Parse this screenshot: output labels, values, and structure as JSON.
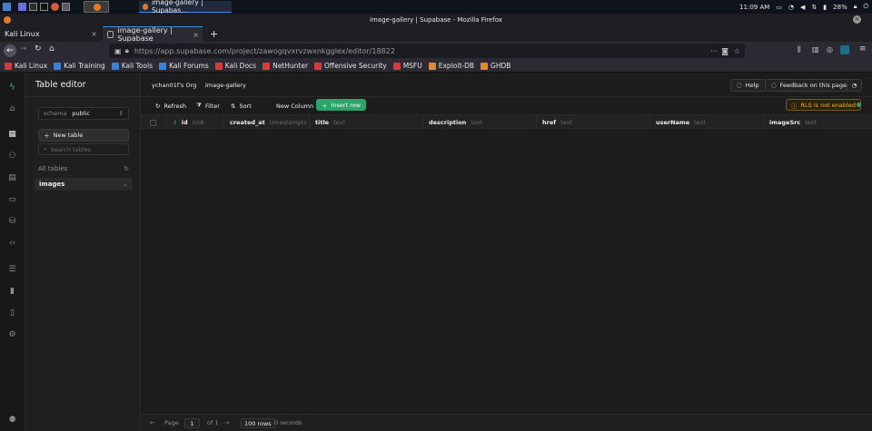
{
  "os": {
    "task_title": "image-gallery | Supabas…",
    "clock": "11:09 AM",
    "battery": "28%"
  },
  "window_title": "image-gallery | Supabase - Mozilla Firefox",
  "tabs": [
    {
      "label": "Kali Linux",
      "close": "×"
    },
    {
      "label": "image-gallery | Supabase",
      "close": "×"
    }
  ],
  "new_tab": "+",
  "url": "https://app.supabase.com/project/zawogqvxrvzwxnkgglex/editor/18822",
  "url_domain": "supabase.com",
  "bookmarks": [
    {
      "label": "Kali Linux",
      "color": "#d63b3b"
    },
    {
      "label": "Kali Training",
      "color": "#3b82d6"
    },
    {
      "label": "Kali Tools",
      "color": "#3b82d6"
    },
    {
      "label": "Kali Forums",
      "color": "#3b82d6"
    },
    {
      "label": "Kali Docs",
      "color": "#d63b3b"
    },
    {
      "label": "NetHunter",
      "color": "#d63b3b"
    },
    {
      "label": "Offensive Security",
      "color": "#d63b3b"
    },
    {
      "label": "MSFU",
      "color": "#d63b3b"
    },
    {
      "label": "Exploit-DB",
      "color": "#e08a2a"
    },
    {
      "label": "GHDB",
      "color": "#e08a2a"
    }
  ],
  "sidebar": {
    "title": "Table editor",
    "schema_label": "schema",
    "schema_value": "public",
    "new_table": "New table",
    "search_placeholder": "Search tables",
    "all_tables": "All tables",
    "tables": [
      "images"
    ]
  },
  "main": {
    "org": "ychan01f's Org",
    "project": "image-gallery",
    "help": "Help",
    "feedback": "Feedback on this page?",
    "toolbar": {
      "refresh": "Refresh",
      "filter": "Filter",
      "sort": "Sort",
      "new_column": "New Column",
      "insert_row": "Insert row",
      "rls": "RLS is not enabled"
    },
    "columns": [
      {
        "name": "id",
        "type": "int8"
      },
      {
        "name": "created_at",
        "type": "timestamptz"
      },
      {
        "name": "title",
        "type": "text"
      },
      {
        "name": "description",
        "type": "text"
      },
      {
        "name": "href",
        "type": "text"
      },
      {
        "name": "userName",
        "type": "text"
      },
      {
        "name": "imageSrc",
        "type": "text"
      }
    ],
    "footer": {
      "page_label": "Page",
      "page_value": "1",
      "of_pages": "of 1",
      "rows_per_page": "100 rows",
      "records": "0 records"
    }
  },
  "colors": {
    "accent_green": "#2ea36a",
    "rls_warning": "#f0b429",
    "browser_focus": "#3b8eea"
  }
}
